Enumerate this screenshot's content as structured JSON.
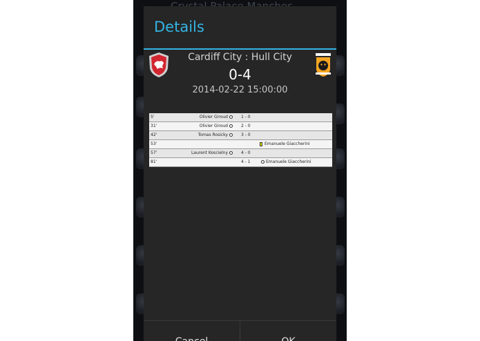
{
  "background": {
    "list_header": "Crystal Palace  Manches"
  },
  "dialog": {
    "title": "Details",
    "accent_color": "#33b5e5",
    "home_crest_icon": "cardiff-city-crest-icon",
    "away_crest_icon": "hull-city-crest-icon",
    "teams": "Cardiff City : Hull City",
    "score": "0-4",
    "datetime": "2014-02-22 15:00:00"
  },
  "events": [
    {
      "minute": "5'",
      "home_player": "Olivier Giroud",
      "home_icon": "soccer-ball-icon",
      "score": "1 - 0",
      "away_player": "",
      "away_icon": ""
    },
    {
      "minute": "31'",
      "home_player": "Olivier Giroud",
      "home_icon": "soccer-ball-icon",
      "score": "2 - 0",
      "away_player": "",
      "away_icon": ""
    },
    {
      "minute": "42'",
      "home_player": "Tomas Rosicky",
      "home_icon": "soccer-ball-icon",
      "score": "3 - 0",
      "away_player": "",
      "away_icon": ""
    },
    {
      "minute": "53'",
      "home_player": "",
      "home_icon": "",
      "score": "",
      "away_player": "Emanuele Giaccherini",
      "away_icon": "yellow-card-icon"
    },
    {
      "minute": "57'",
      "home_player": "Laurent Koscielny",
      "home_icon": "soccer-ball-icon",
      "score": "4 - 0",
      "away_player": "",
      "away_icon": ""
    },
    {
      "minute": "81'",
      "home_player": "",
      "home_icon": "",
      "score": "4 - 1",
      "away_player": "Emanuele Giaccherini",
      "away_icon": "soccer-ball-icon"
    }
  ],
  "buttons": {
    "cancel": "Cancel",
    "ok": "OK"
  }
}
